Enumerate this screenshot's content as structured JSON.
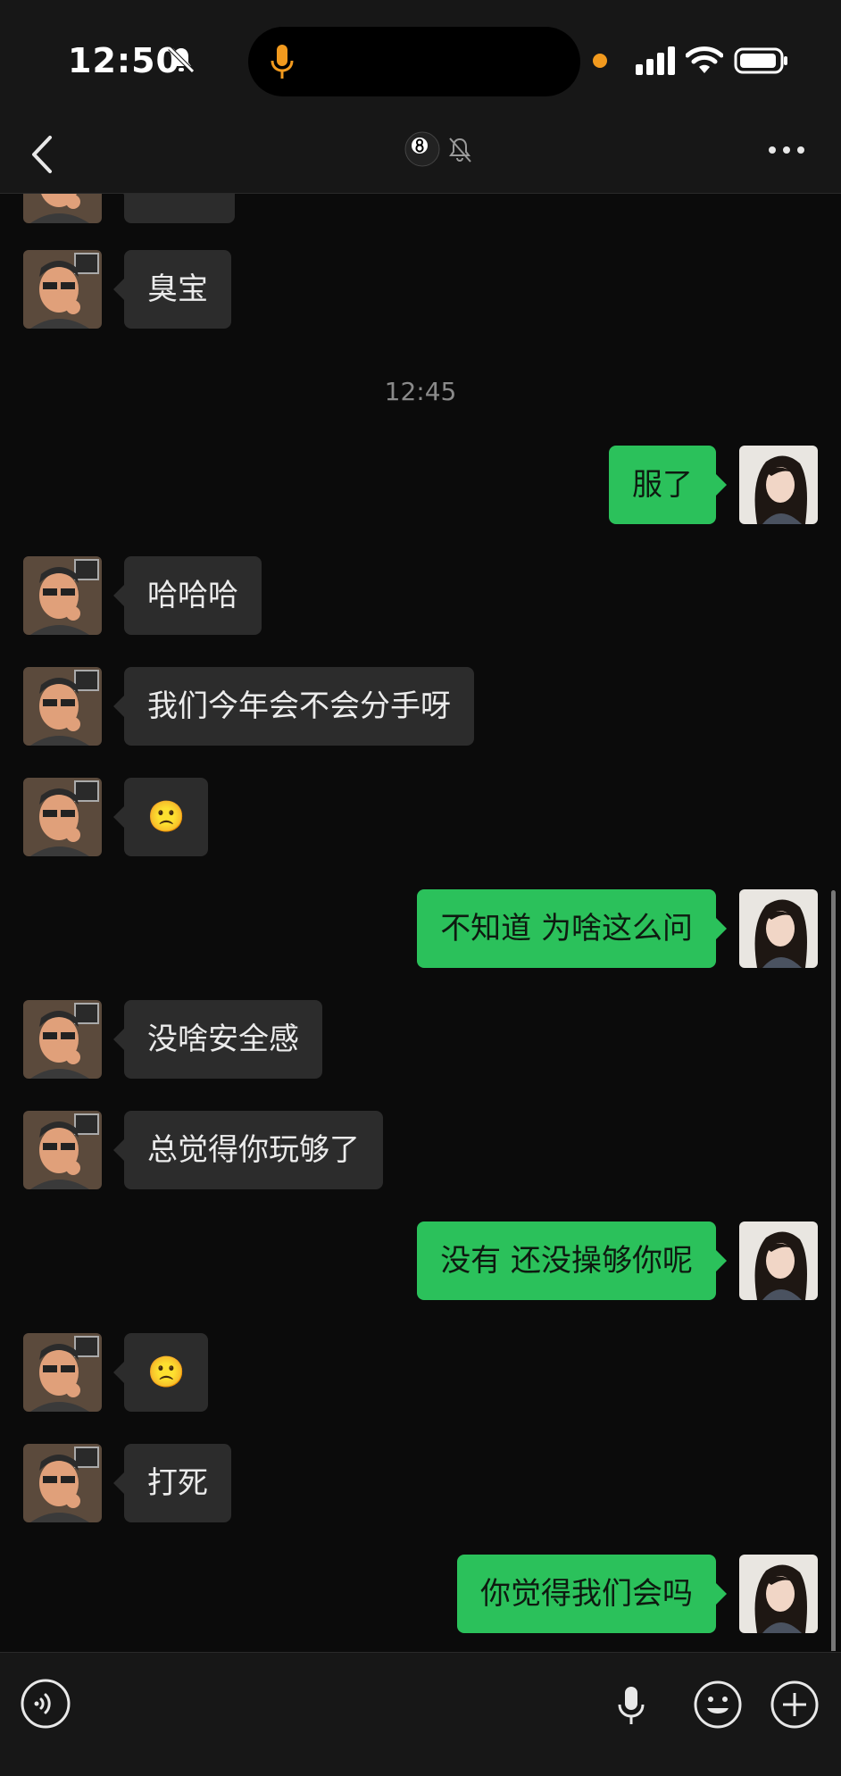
{
  "status_bar": {
    "time": "12:50"
  },
  "messages": [
    {
      "type": "in",
      "text": "臭宝"
    },
    {
      "type": "time",
      "text": "12:45"
    },
    {
      "type": "out",
      "text": "服了"
    },
    {
      "type": "in",
      "text": "哈哈哈"
    },
    {
      "type": "in",
      "text": "我们今年会不会分手呀"
    },
    {
      "type": "in",
      "text": "🙁"
    },
    {
      "type": "out",
      "text": "不知道 为啥这么问"
    },
    {
      "type": "in",
      "text": "没啥安全感"
    },
    {
      "type": "in",
      "text": "总觉得你玩够了"
    },
    {
      "type": "out",
      "text": "没有 还没操够你呢"
    },
    {
      "type": "in",
      "text": "🙁"
    },
    {
      "type": "in",
      "text": "打死"
    },
    {
      "type": "out",
      "text": "你觉得我们会吗"
    }
  ],
  "colors": {
    "outgoing_bubble": "#2bc15b",
    "incoming_bubble": "#2c2c2c",
    "background": "#0b0b0b"
  },
  "icons": [
    "back-icon",
    "8-ball-icon",
    "mute-bell-icon",
    "more-icon",
    "voice-mode-icon",
    "mic-icon",
    "emoji-icon",
    "plus-icon"
  ]
}
